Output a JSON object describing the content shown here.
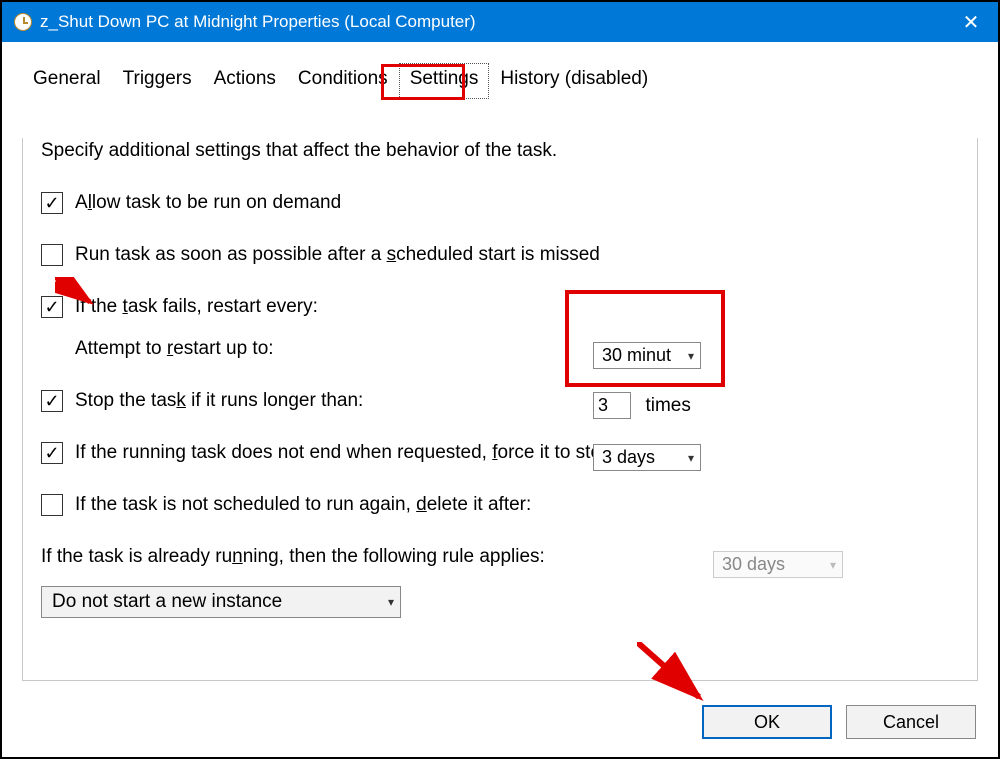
{
  "window": {
    "title": "z_Shut Down PC at Midnight Properties (Local Computer)"
  },
  "tabs": {
    "items": [
      {
        "label": "General"
      },
      {
        "label": "Triggers"
      },
      {
        "label": "Actions"
      },
      {
        "label": "Conditions"
      },
      {
        "label": "Settings",
        "selected": true
      },
      {
        "label": "History (disabled)"
      }
    ]
  },
  "settings": {
    "intro": "Specify additional settings that affect the behavior of the task.",
    "allow_run_on_demand": {
      "label_pre": "A",
      "label_u": "l",
      "label_post": "low task to be run on demand",
      "checked": true
    },
    "run_asap_missed": {
      "label_pre": "Run task as soon as possible after a ",
      "label_u": "s",
      "label_post": "cheduled start is missed",
      "checked": false
    },
    "if_fails_restart": {
      "label_pre": "If the ",
      "label_u": "t",
      "label_post": "ask fails, restart every:",
      "checked": true,
      "value": "30 minut"
    },
    "attempt_restart": {
      "label_pre": "Attempt to ",
      "label_u": "r",
      "label_post": "estart up to:",
      "value": "3",
      "suffix": "times"
    },
    "stop_if_longer": {
      "label_pre": "Stop the tas",
      "label_u": "k",
      "label_post": " if it runs longer than:",
      "checked": true,
      "value": "3 days"
    },
    "force_stop": {
      "label_pre": "If the running task does not end when requested, ",
      "label_u": "f",
      "label_post": "orce it to stop",
      "checked": true
    },
    "delete_if_not_scheduled": {
      "label_pre": "If the task is not scheduled to run again, ",
      "label_u": "d",
      "label_post": "elete it after:",
      "checked": false,
      "value": "30 days"
    },
    "rule_label_pre": "If the task is already ru",
    "rule_label_u": "n",
    "rule_label_post": "ning, then the following rule applies:",
    "rule_value": "Do not start a new instance"
  },
  "buttons": {
    "ok": "OK",
    "cancel": "Cancel"
  }
}
